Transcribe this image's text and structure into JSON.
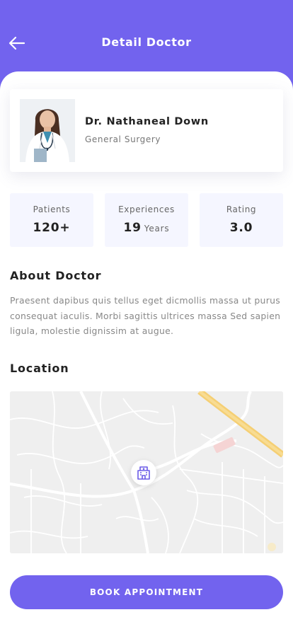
{
  "header": {
    "title": "Detail Doctor",
    "back_icon": "arrow-left-icon",
    "color": "#7263ee"
  },
  "doctor": {
    "name": "Dr. Nathaneal Down",
    "specialty": "General Surgery"
  },
  "stats": [
    {
      "label": "Patients",
      "value": "120+",
      "unit": ""
    },
    {
      "label": "Experiences",
      "value": "19",
      "unit": "Years"
    },
    {
      "label": "Rating",
      "value": "3.0",
      "unit": ""
    }
  ],
  "about": {
    "title": "About Doctor",
    "text": "Praesent dapibus quis tellus eget dicmollis massa ut purus consequat iaculis. Morbi sagittis ultrices massa Sed sapien ligula, molestie dignissim at augue."
  },
  "location": {
    "title": "Location",
    "pin_icon": "hospital-icon"
  },
  "actions": {
    "book_label": "BOOK APPOINTMENT"
  }
}
